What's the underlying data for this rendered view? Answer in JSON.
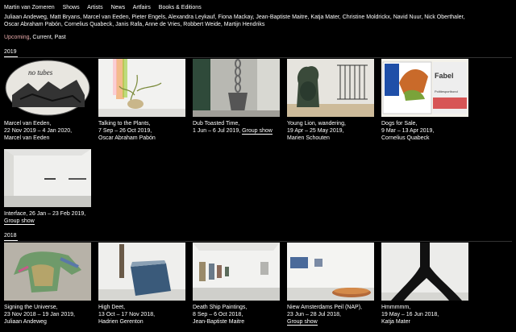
{
  "site": {
    "name": "Martin van Zomeren"
  },
  "nav": [
    {
      "label": "Shows"
    },
    {
      "label": "Artists"
    },
    {
      "label": "News"
    },
    {
      "label": "Artfairs"
    },
    {
      "label": "Books & Editions"
    }
  ],
  "artists_line": "Juliaan Andeweg, Matt Bryans, Marcel van Eeden, Pieter Engels, Alexandra Leykauf, Fiona Mackay, Jean-Baptiste Maitre, Katja Mater, Christine Moldrickx, Navid Nuur, Nick Oberthaler,",
  "artists_line2": "Oscar Abraham Pabón, Cornelius Quabeck, Janis Rafa, Anne de Vries, Robbert Weide, Martijn Hendriks",
  "filter": {
    "upcoming": "Upcoming",
    "sep1": ",",
    "current": "Current",
    "sep2": ",",
    "past": "Past"
  },
  "sections": [
    {
      "year": "2019",
      "shows": [
        {
          "title": "Marcel van Eeden,",
          "dates": "22 Nov 2019 – 4 Jan 2020,",
          "artist": "Marcel van Eeden",
          "group": ""
        },
        {
          "title": "Talking to the Plants,",
          "dates": "7 Sep – 26 Oct 2019,",
          "artist": "Oscar Abraham Pabón",
          "group": ""
        },
        {
          "title": "Dub Toasted Time,",
          "dates": "1 Jun – 6 Jul 2019,",
          "artist": "",
          "group": "Group show"
        },
        {
          "title": "Young Lion, wandering,",
          "dates": "19 Apr – 25 May 2019,",
          "artist": "Marien Schouten",
          "group": ""
        },
        {
          "title": "Dogs for Sale,",
          "dates": "9 Mar – 13 Apr 2019,",
          "artist": "Cornelius Quabeck",
          "group": ""
        },
        {
          "title": "Interface,",
          "dates": "26 Jan – 23 Feb 2019,",
          "artist": "",
          "group": "Group show"
        }
      ]
    },
    {
      "year": "2018",
      "shows": [
        {
          "title": "Signing the Universe,",
          "dates": "23 Nov 2018 – 19 Jan 2019,",
          "artist": "Juliaan Andeweg",
          "group": ""
        },
        {
          "title": "High Deet,",
          "dates": "13 Oct – 17 Nov 2018,",
          "artist": "Hadrien Gerenton",
          "group": ""
        },
        {
          "title": "Death Ship Paintings,",
          "dates": "8 Sep – 6 Oct 2018,",
          "artist": "Jean-Baptiste Maitre",
          "group": ""
        },
        {
          "title": "Niew Amsterdams Peil (NAP),",
          "dates": "23 Jun – 28 Jul 2018,",
          "artist": "",
          "group": "Group show"
        },
        {
          "title": "Hmmmmm,",
          "dates": "19 May – 16 Jun 2018,",
          "artist": "Katja Mater",
          "group": ""
        }
      ]
    }
  ],
  "thumb_text": {
    "dogs": "Fabel",
    "dogs_sub": "Politiesportbond",
    "eeden": "no tubes"
  },
  "colors": {
    "background": "#000000",
    "text": "#ffffff",
    "active_filter": "#e6a9a9"
  }
}
